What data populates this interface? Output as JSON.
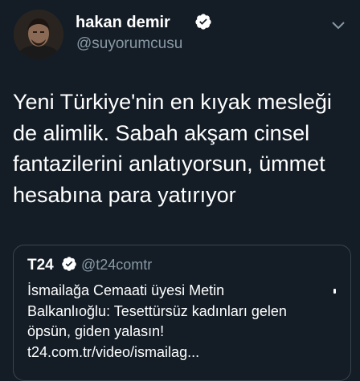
{
  "author": {
    "name": "hakan demir",
    "handle": "@suyorumcusu",
    "verified": true,
    "avatar_icon": "person-avatar"
  },
  "tweet": {
    "lines": [
      "Yeni Türkiye'nin en kıyak mesleği",
      "de alimlik. Sabah akşam cinsel",
      "fantazilerini anlatıyorsun, ümmet",
      "hesabına para yatırıyor"
    ]
  },
  "quoted": {
    "name": "T24",
    "handle": "@t24comtr",
    "verified": true,
    "lines": [
      "İsmailağa Cemaati üyesi Metin",
      "Balkanlıoğlu: Tesettürsüz kadınları gelen",
      "öpsün, giden yalasın!",
      "t24.com.tr/video/ismailag..."
    ]
  },
  "icons": {
    "verified_badge": "verified-badge-icon",
    "menu": "chevron-down-icon"
  },
  "colors": {
    "background": "#141d26",
    "secondary_text": "#8899a6",
    "border": "#38444d",
    "verified": "#ffffff"
  }
}
